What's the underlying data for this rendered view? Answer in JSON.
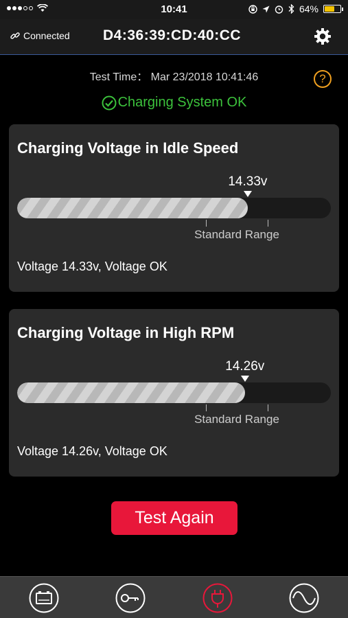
{
  "status_bar": {
    "time": "10:41",
    "battery_percent": "64%",
    "battery_level": 0.64
  },
  "nav": {
    "connection_label": "Connected",
    "device_id": "D4:36:39:CD:40:CC"
  },
  "header": {
    "test_time": "Test Time： Mar 23/2018 10:41:46",
    "help_symbol": "?",
    "overall_status": "Charging System OK",
    "status_color": "#3cc23c"
  },
  "cards": [
    {
      "title": "Charging Voltage in Idle Speed",
      "value_label": "14.33v",
      "level": 0.735,
      "range_label": "Standard Range",
      "result": "Voltage 14.33v, Voltage OK"
    },
    {
      "title": "Charging Voltage in High RPM",
      "value_label": "14.26v",
      "level": 0.726,
      "range_label": "Standard Range",
      "result": "Voltage 14.26v, Voltage OK"
    }
  ],
  "actions": {
    "test_again_label": "Test Again",
    "accent_color": "#e8173a"
  },
  "tabbar": {
    "tabs": [
      {
        "icon": "battery-icon",
        "active": false
      },
      {
        "icon": "key-icon",
        "active": false
      },
      {
        "icon": "plug-icon",
        "active": true
      },
      {
        "icon": "waveform-icon",
        "active": false
      }
    ],
    "active_color": "#e8173a"
  }
}
